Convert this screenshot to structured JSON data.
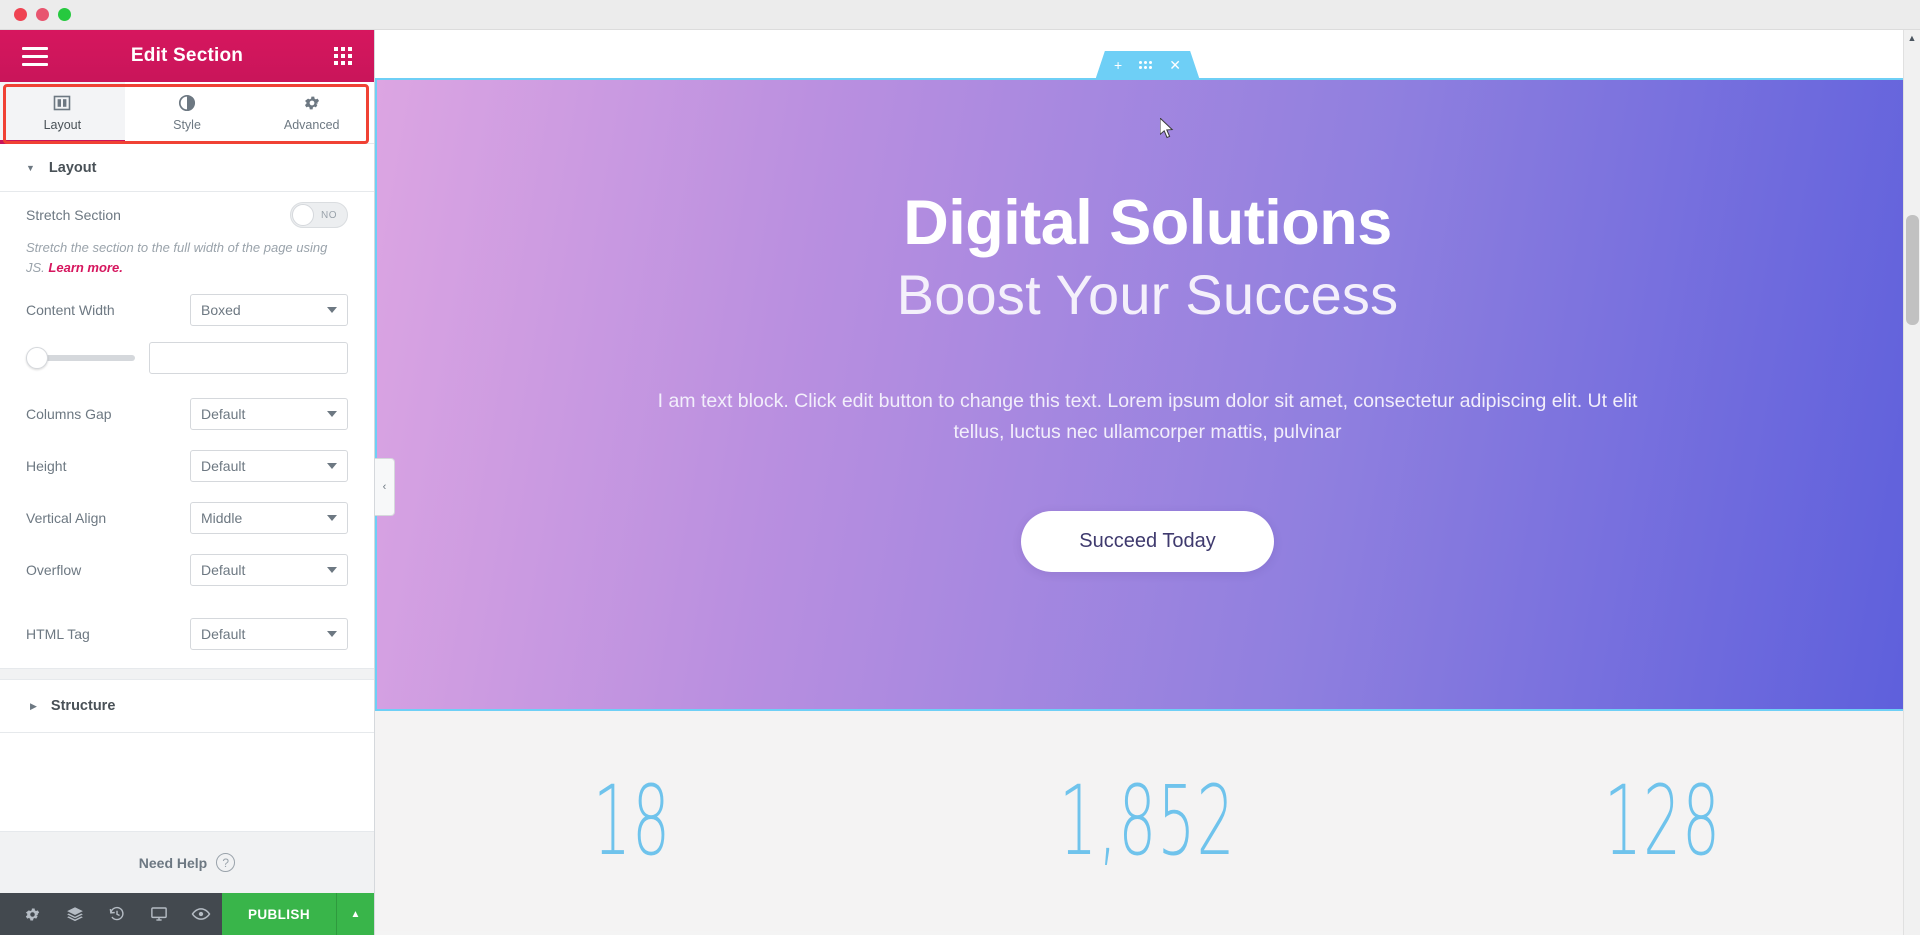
{
  "window": {
    "controls": [
      "close",
      "minimize",
      "maximize"
    ]
  },
  "panel": {
    "header": {
      "title": "Edit Section",
      "menu_icon": "hamburger-icon",
      "grid_icon": "grid-apps-icon"
    },
    "tabs": [
      {
        "label": "Layout",
        "icon": "columns-icon",
        "active": true
      },
      {
        "label": "Style",
        "icon": "contrast-circle-icon",
        "active": false
      },
      {
        "label": "Advanced",
        "icon": "gear-icon",
        "active": false
      }
    ],
    "sections": {
      "layout": {
        "title": "Layout",
        "expanded": true,
        "controls": {
          "stretch_section": {
            "label": "Stretch Section",
            "toggle_value": "NO",
            "help_text": "Stretch the section to the full width of the page using JS.",
            "help_link": "Learn more."
          },
          "content_width": {
            "label": "Content Width",
            "value": "Boxed"
          },
          "content_width_slider": {
            "value": "",
            "placeholder": ""
          },
          "columns_gap": {
            "label": "Columns Gap",
            "value": "Default"
          },
          "height": {
            "label": "Height",
            "value": "Default"
          },
          "vertical_align": {
            "label": "Vertical Align",
            "value": "Middle"
          },
          "overflow": {
            "label": "Overflow",
            "value": "Default"
          },
          "html_tag": {
            "label": "HTML Tag",
            "value": "Default"
          }
        }
      },
      "structure": {
        "title": "Structure",
        "expanded": false
      }
    },
    "need_help": {
      "label": "Need Help",
      "icon": "question-mark-icon"
    },
    "footer": {
      "icons": [
        {
          "name": "settings-gear-icon",
          "glyph": "⚙"
        },
        {
          "name": "layers-navigator-icon",
          "glyph": "⧉"
        },
        {
          "name": "history-revisions-icon",
          "glyph": "↺"
        },
        {
          "name": "responsive-mode-icon",
          "glyph": "⎕"
        },
        {
          "name": "preview-eye-icon",
          "glyph": "◉"
        }
      ],
      "publish_label": "PUBLISH",
      "publish_arrow": "▲",
      "publish_color": "#39b54a"
    }
  },
  "collapse_handle": {
    "icon": "chevron-left-icon",
    "glyph": "‹"
  },
  "canvas": {
    "section_toolbar": {
      "add_icon": "plus-icon",
      "drag_icon": "drag-dots-icon",
      "close_icon": "close-x-icon",
      "color": "#6ecff6"
    },
    "hero": {
      "heading": "Digital Solutions",
      "subheading": "Boost Your Success",
      "paragraph": "I am text block. Click edit button to change this text. Lorem ipsum dolor sit amet, consectetur adipiscing elit. Ut elit tellus, luctus nec ullamcorper mattis, pulvinar",
      "button_label": "Succeed Today",
      "gradient_from": "#dca5e2",
      "gradient_to": "#5d5fdc"
    },
    "counters": [
      {
        "value": "18"
      },
      {
        "value": "1,852"
      },
      {
        "value": "128"
      }
    ],
    "counter_color": "#6fc3ec"
  },
  "scrollbar": {
    "up_arrow": "▲"
  }
}
